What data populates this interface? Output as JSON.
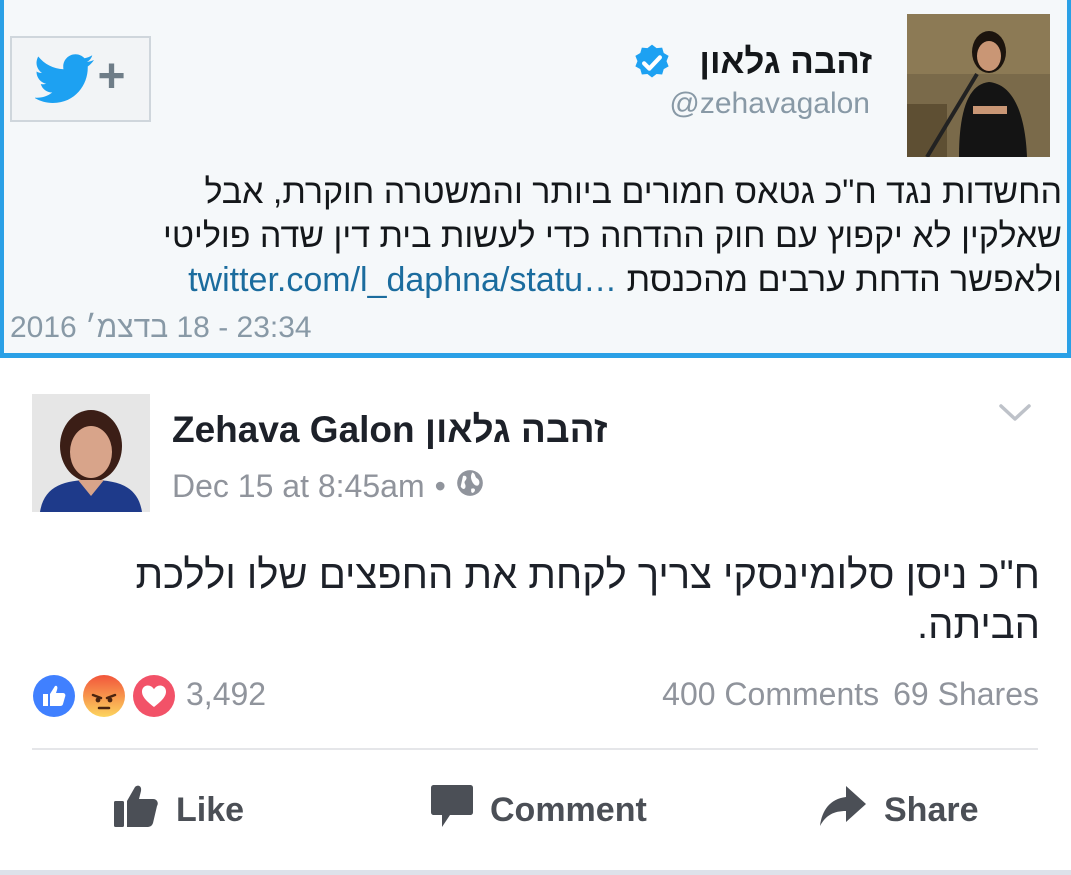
{
  "tweet": {
    "display_name": "זהבה גלאון",
    "handle": "@zehavagalon",
    "text_lines": [
      "החשדות נגד ח\"כ גטאס חמורים ביותר והמשטרה חוקרת, אבל",
      "שאלקין לא יקפוץ עם חוק ההדחה כדי לעשות בית דין שדה פוליטי"
    ],
    "text_last_line": "ולאפשר הדחת ערבים מהכנסת",
    "link_text": "twitter.com/l_daphna/statu…",
    "timestamp": "23:34 - 18 בדצמ׳ 2016",
    "follow_plus": "+",
    "icons": {
      "follow": "twitter-bird-icon",
      "verified": "verified-badge-icon"
    },
    "colors": {
      "twitter_blue": "#1da1f2",
      "frame_blue": "#2aa0e6",
      "link": "#1b6c9e"
    }
  },
  "facebook": {
    "name": "Zehava Galon זהבה גלאון",
    "date": "Dec 15 at 8:45am",
    "separator": "•",
    "text_lines": [
      "ח\"כ ניסן סלומינסקי צריך לקחת את החפצים שלו וללכת",
      "הביתה."
    ],
    "reaction_count": "3,492",
    "comments": "400 Comments",
    "shares": "69 Shares",
    "actions": {
      "like": "Like",
      "comment": "Comment",
      "share": "Share"
    },
    "reaction_types": [
      "like",
      "angry",
      "love"
    ],
    "icons": {
      "audience": "globe-icon",
      "menu": "chevron-down-icon"
    },
    "colors": {
      "like_blue": "#4080ff",
      "love_red": "#f25268",
      "angry_orange": "#f7714c",
      "action_gray": "#4b4f56"
    }
  }
}
